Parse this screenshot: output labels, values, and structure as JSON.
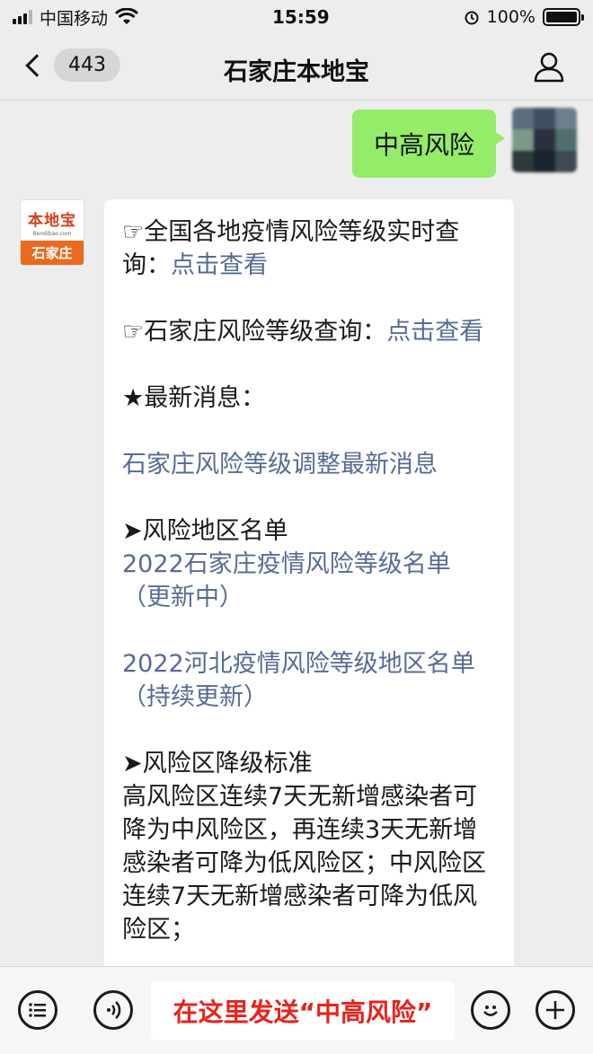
{
  "status_bar": {
    "carrier": "中国移动",
    "time": "15:59",
    "battery": "100%"
  },
  "nav": {
    "unread_count": "443",
    "title": "石家庄本地宝"
  },
  "sent": {
    "text": "中高风险"
  },
  "bot_avatar": {
    "logo": "本地宝",
    "domain": "Bendibao.com",
    "city": "石家庄"
  },
  "reply": {
    "line1_prefix": "☞全国各地疫情风险等级实时查询：",
    "line1_link": "点击查看",
    "line2_prefix": "☞石家庄风险等级查询：",
    "line2_link": "点击查看",
    "news_heading": "★最新消息：",
    "news_link": "石家庄风险等级调整最新消息",
    "list_heading": "➤风险地区名单",
    "list_link1": "2022石家庄疫情风险等级名单（更新中）",
    "list_link2": "2022河北疫情风险等级地区名单（持续更新）",
    "standard_heading": "➤风险区降级标准",
    "standard_text": "高风险区连续7天无新增感染者可降为中风险区，再连续3天无新增感染者可降为低风险区；中风险区连续7天无新增感染者可降为低风险区；"
  },
  "input_bar": {
    "hint": "在这里发送“中高风险”"
  },
  "colors": {
    "sent_bubble": "#95ec69",
    "link": "#576b95",
    "hint_text": "#e8221b"
  }
}
